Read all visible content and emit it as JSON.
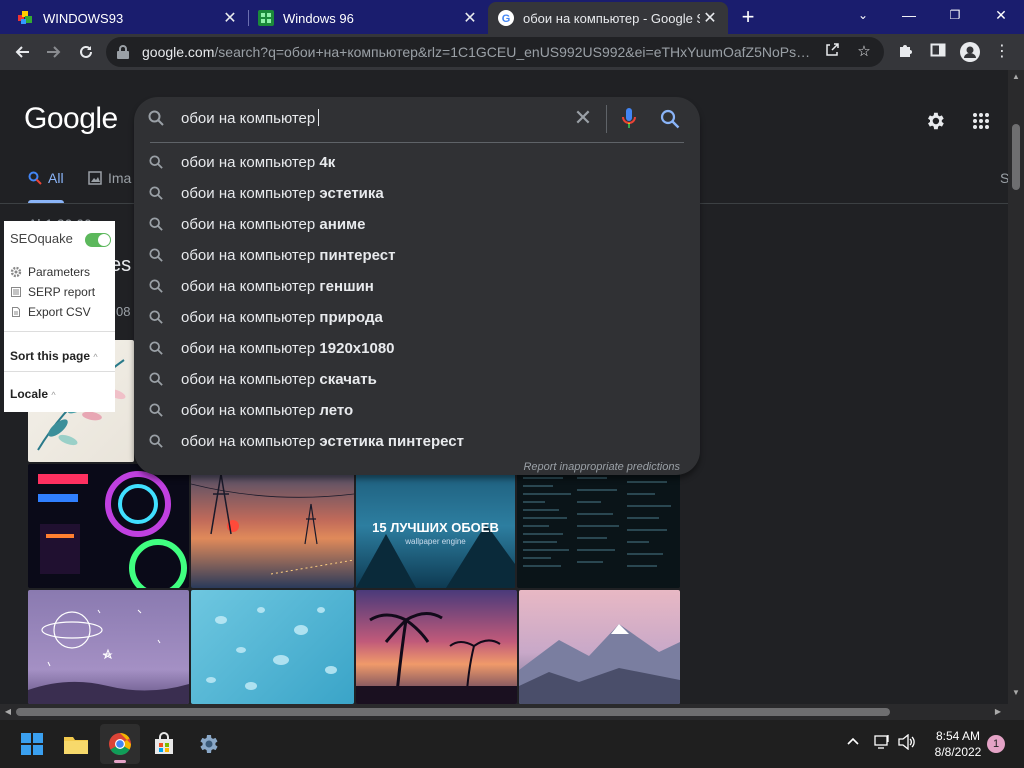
{
  "browser": {
    "tabs": [
      {
        "title": "WINDOWS93",
        "active": false
      },
      {
        "title": "Windows 96",
        "active": false
      },
      {
        "title": "обои на компьютер - Google Se",
        "active": true
      }
    ],
    "url_host": "google.com",
    "url_path": "/search?q=обои+на+компьютер&rlz=1C1GCEU_enUS992US992&ei=eTHxYuumOafZ5NoPse..."
  },
  "google": {
    "logo": "Google",
    "tab_all": "All",
    "tab_images": "Ima",
    "tab_more": "S",
    "frag_results": "Ab1 20 00",
    "frag_heading": "es",
    "frag_small": "08"
  },
  "search": {
    "query": "обои на компьютер",
    "suggestions": [
      {
        "prefix": "обои на компьютер ",
        "bold": "4к"
      },
      {
        "prefix": "обои на компьютер ",
        "bold": "эстетика"
      },
      {
        "prefix": "обои на компьютер ",
        "bold": "аниме"
      },
      {
        "prefix": "обои на компьютер ",
        "bold": "пинтерест"
      },
      {
        "prefix": "обои на компьютер ",
        "bold": "геншин"
      },
      {
        "prefix": "обои на компьютер ",
        "bold": "природа"
      },
      {
        "prefix": "обои на компьютер ",
        "bold": "1920x1080"
      },
      {
        "prefix": "обои на компьютер ",
        "bold": "скачать"
      },
      {
        "prefix": "обои на компьютер ",
        "bold": "лето"
      },
      {
        "prefix": "обои на компьютер ",
        "bold": "эстетика пинтерест"
      }
    ],
    "report_link": "Report inappropriate predictions"
  },
  "seoquake": {
    "title": "SEOquake",
    "enabled": true,
    "items": [
      "Parameters",
      "SERP report",
      "Export CSV"
    ],
    "sort_label": "Sort this page",
    "locale_label": "Locale"
  },
  "images": {
    "thumb_caption_line1": "15 ЛУЧШИХ ОБОЕВ",
    "thumb_caption_line2": "wallpaper engine"
  },
  "taskbar": {
    "time": "8:54 AM",
    "date": "8/8/2022",
    "notifications": "1"
  },
  "colors": {
    "tabstrip": "#1a1d6e",
    "accent_blue": "#8ab4f8",
    "seo_toggle": "#5cb85c"
  }
}
